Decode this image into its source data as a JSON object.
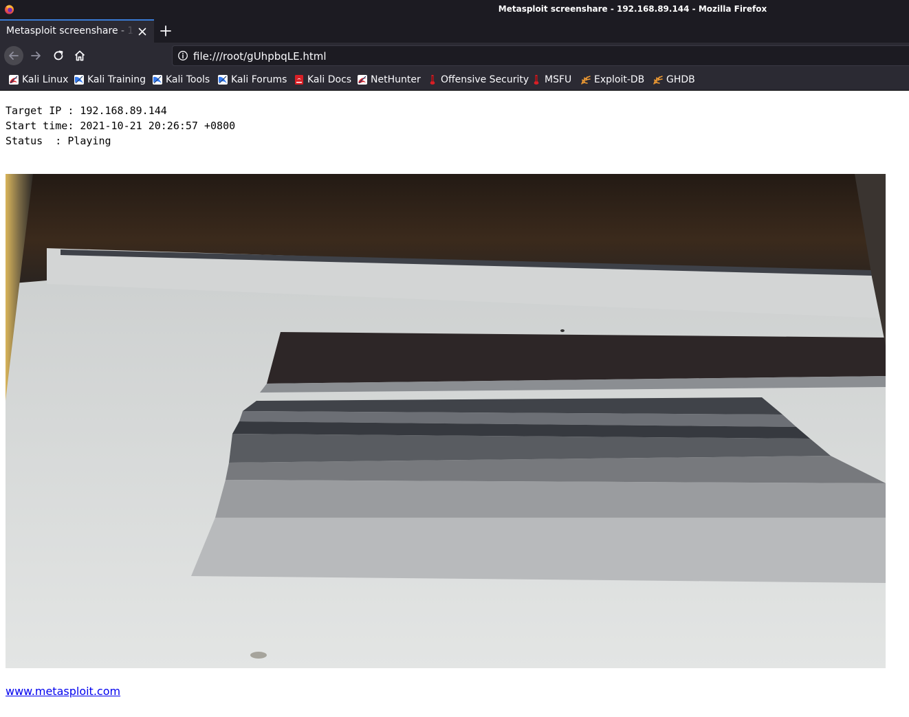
{
  "window": {
    "title": "Metasploit screenshare - 192.168.89.144 - Mozilla Firefox"
  },
  "tabs": [
    {
      "label": "Metasploit screenshare - 192.168.89.144",
      "active": true
    }
  ],
  "urlbar": {
    "url": "file:///root/gUhpbqLE.html"
  },
  "bookmarks": [
    {
      "label": "Kali Linux",
      "icon": "kali-icon"
    },
    {
      "label": "Kali Training",
      "icon": "kali-training-icon"
    },
    {
      "label": "Kali Tools",
      "icon": "kali-tools-icon"
    },
    {
      "label": "Kali Forums",
      "icon": "kali-forums-icon"
    },
    {
      "label": "Kali Docs",
      "icon": "kali-docs-icon"
    },
    {
      "label": "NetHunter",
      "icon": "nethunter-icon"
    },
    {
      "label": "Offensive Security",
      "icon": "offsec-icon"
    },
    {
      "label": "MSFU",
      "icon": "msfu-icon"
    },
    {
      "label": "Exploit-DB",
      "icon": "exploitdb-icon"
    },
    {
      "label": "GHDB",
      "icon": "ghdb-icon"
    }
  ],
  "session": {
    "target_ip_label": "Target IP ",
    "target_ip": "192.168.89.144",
    "start_time_label": "Start time",
    "start_time": "2021-10-21 20:26:57 +0800",
    "status_label": "Status  ",
    "status": "Playing"
  },
  "footer": {
    "link_text": "www.metasploit.com"
  },
  "colors": {
    "chrome_dark": "#1c1b22",
    "chrome": "#2b2a33",
    "tab_accent": "#3a7bd5",
    "kali_blue": "#367bf0",
    "offsec_red": "#d81f26",
    "exploitdb_orange": "#f29c33",
    "link": "#0000ee"
  }
}
